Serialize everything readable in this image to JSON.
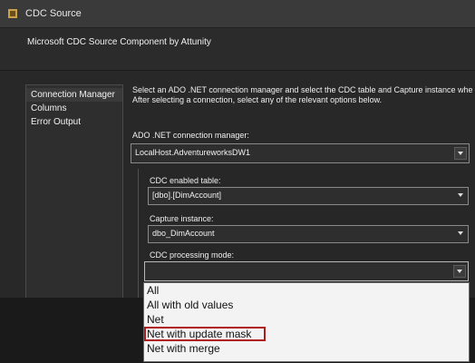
{
  "window": {
    "title": "CDC Source"
  },
  "header": {
    "component_title": "Microsoft CDC Source Component by Attunity"
  },
  "nav": {
    "items": [
      {
        "label": "Connection Manager"
      },
      {
        "label": "Columns"
      },
      {
        "label": "Error Output"
      }
    ]
  },
  "main": {
    "description_line1": "Select an ADO .NET connection manager and select the CDC table and Capture instance whe",
    "description_line2": "After selecting a connection, select any of the relevant options below.",
    "connection_label": "ADO .NET connection manager:",
    "connection_value": "LocalHost.AdventureworksDW1",
    "table_label": "CDC enabled table:",
    "table_value": "[dbo].[DimAccount]",
    "capture_label": "Capture instance:",
    "capture_value": "dbo_DimAccount",
    "mode_label": "CDC processing mode:",
    "mode_value": ""
  },
  "dropdown": {
    "options": [
      "All",
      "All with old values",
      "Net",
      "Net with update mask",
      "Net with merge"
    ],
    "highlighted": "Net with update mask"
  },
  "colors": {
    "highlight_border": "#b01a1a"
  }
}
